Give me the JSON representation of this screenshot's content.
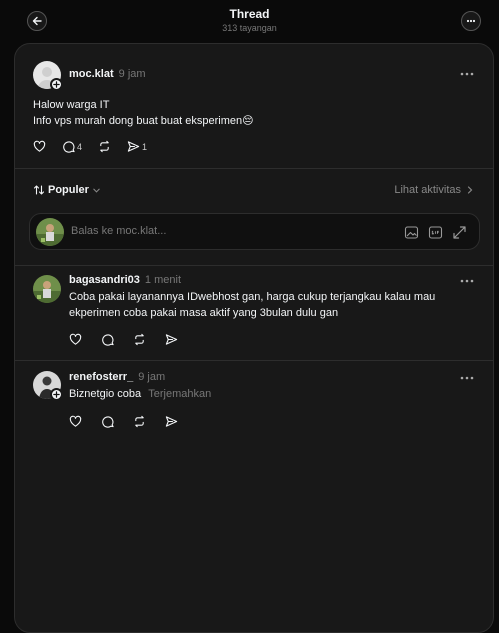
{
  "header": {
    "title": "Thread",
    "views": "313 tayangan"
  },
  "main_post": {
    "username": "moc.klat",
    "time": "9 jam",
    "line1": "Halow warga IT",
    "line2": "Info vps murah dong buat buat eksperimen😔",
    "comment_count": "4",
    "share_count": "1"
  },
  "sort_bar": {
    "sort_label": "Populer",
    "activity_label": "Lihat aktivitas"
  },
  "reply_box": {
    "placeholder": "Balas ke moc.klat..."
  },
  "comments": [
    {
      "username": "bagasandri03",
      "time": "1 menit",
      "line1": "Coba pakai layanannya IDwebhost gan, harga cukup terjangkau kalau mau",
      "line2": "ekperimen coba pakai masa aktif yang 3bulan dulu gan"
    },
    {
      "username": "renefosterr_",
      "time": "9 jam",
      "text": "Biznetgio coba",
      "translate": "Terjemahkan"
    }
  ],
  "colors": {
    "background": "#0a0a0a",
    "panel": "#181818",
    "text": "#f3f5f7",
    "muted": "#777777"
  }
}
